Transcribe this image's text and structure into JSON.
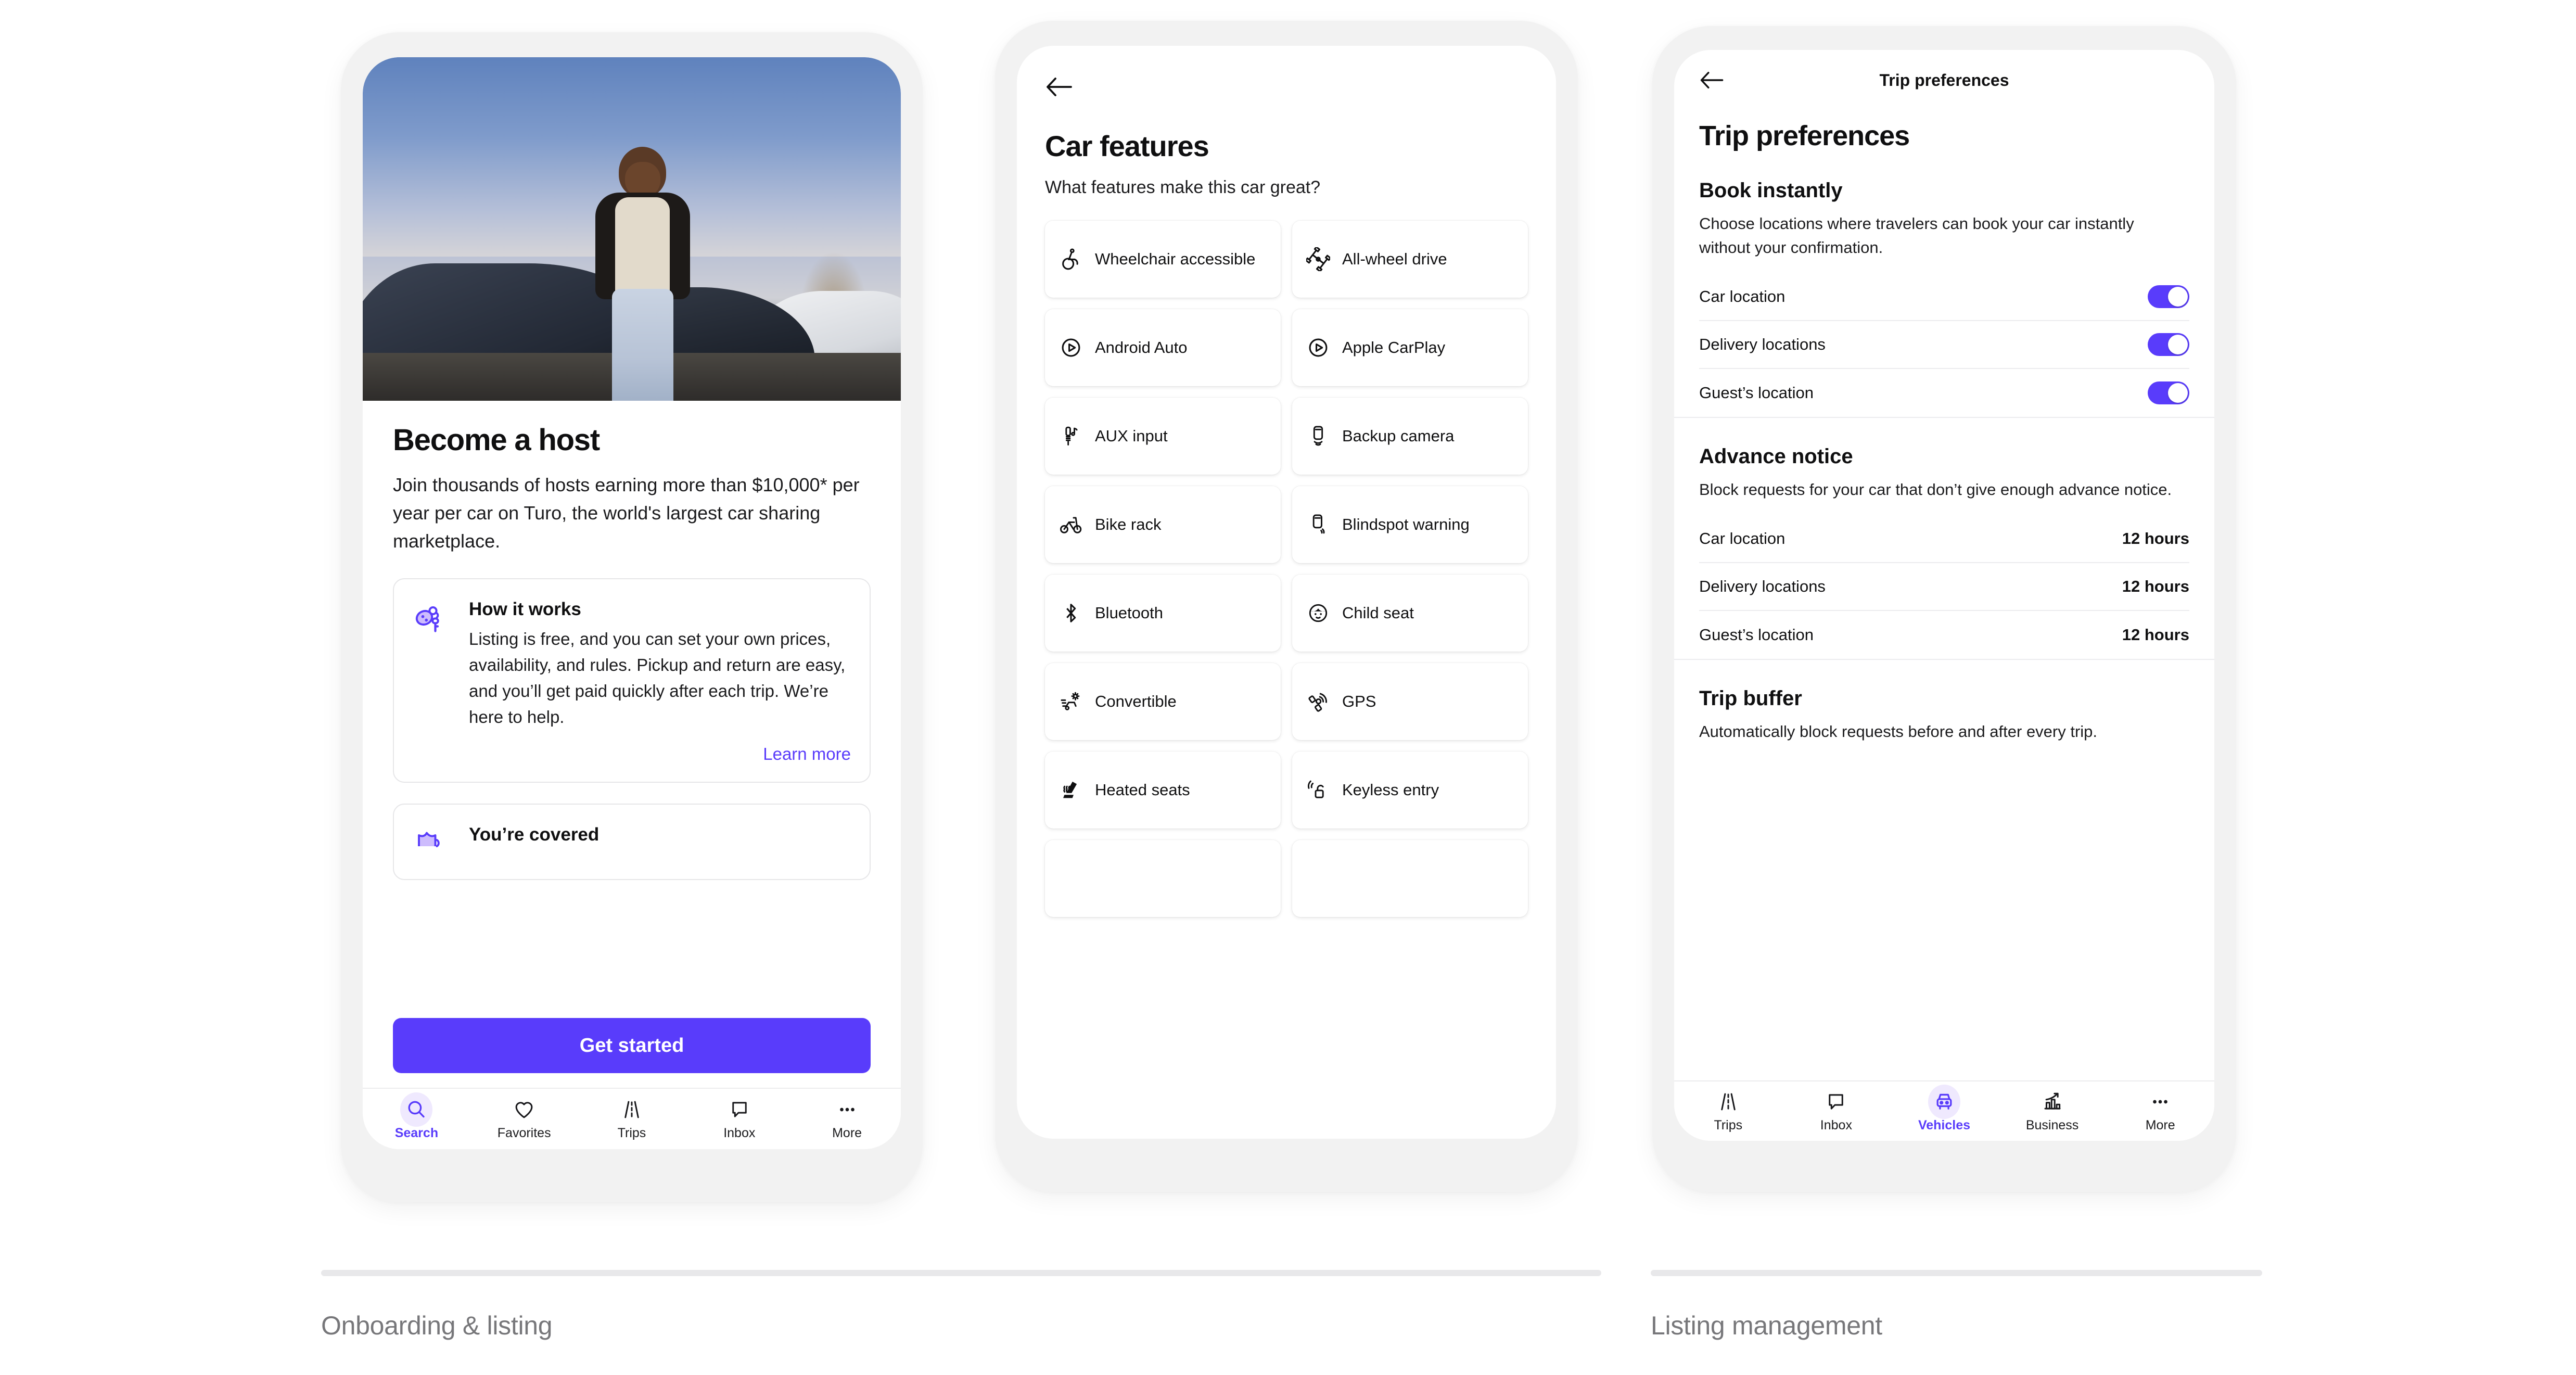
{
  "theme": {
    "accent": "#593CFB",
    "accent_soft": "#efe9fe",
    "text": "#0f0f10",
    "muted": "#77777a",
    "frame": "#f2f2f2"
  },
  "phone1": {
    "hero_alt": "host standing in front of parked sports cars",
    "title": "Become a host",
    "subtitle": "Join thousands of hosts earning more than $10,000* per year per car on Turo, the world's largest car sharing marketplace.",
    "cards": [
      {
        "icon": "car-keys-icon",
        "title": "How it works",
        "text": "Listing is free, and you can set your own prices, availability, and rules. Pickup and return are easy, and you’ll get paid quickly after each trip. We’re here to help.",
        "link": "Learn more"
      },
      {
        "icon": "shield-icon",
        "title": "You’re covered"
      }
    ],
    "cta": "Get started",
    "tabs": [
      {
        "label": "Search",
        "icon": "search-icon",
        "active": true
      },
      {
        "label": "Favorites",
        "icon": "heart-icon",
        "active": false
      },
      {
        "label": "Trips",
        "icon": "road-icon",
        "active": false
      },
      {
        "label": "Inbox",
        "icon": "message-icon",
        "active": false
      },
      {
        "label": "More",
        "icon": "ellipsis-icon",
        "active": false
      }
    ]
  },
  "phone2": {
    "back": "back-arrow-icon",
    "title": "Car features",
    "subtitle": "What features make this car great?",
    "features": [
      {
        "label": "Wheelchair accessible",
        "icon": "wheelchair-icon"
      },
      {
        "label": "All-wheel drive",
        "icon": "awd-icon"
      },
      {
        "label": "Android Auto",
        "icon": "play-circle-icon"
      },
      {
        "label": "Apple CarPlay",
        "icon": "play-circle-icon"
      },
      {
        "label": "AUX input",
        "icon": "aux-jack-icon"
      },
      {
        "label": "Backup camera",
        "icon": "backup-camera-icon"
      },
      {
        "label": "Bike rack",
        "icon": "bicycle-icon"
      },
      {
        "label": "Blindspot warning",
        "icon": "blindspot-icon"
      },
      {
        "label": "Bluetooth",
        "icon": "bluetooth-icon"
      },
      {
        "label": "Child seat",
        "icon": "child-face-icon"
      },
      {
        "label": "Convertible",
        "icon": "convertible-icon"
      },
      {
        "label": "GPS",
        "icon": "satellite-icon"
      },
      {
        "label": "Heated seats",
        "icon": "heated-seat-icon"
      },
      {
        "label": "Keyless entry",
        "icon": "keyless-lock-icon"
      },
      {
        "label": "",
        "icon": ""
      },
      {
        "label": "",
        "icon": ""
      }
    ]
  },
  "phone3": {
    "back": "back-arrow-icon",
    "header_title": "Trip preferences",
    "page_title": "Trip preferences",
    "sections": [
      {
        "heading": "Book instantly",
        "description": "Choose locations where travelers can book your car instantly without your confirmation.",
        "rows": [
          {
            "label": "Car location",
            "toggle": true
          },
          {
            "label": "Delivery locations",
            "toggle": true
          },
          {
            "label": "Guest’s location",
            "toggle": true
          }
        ]
      },
      {
        "heading": "Advance notice",
        "description": "Block requests for your car that don’t give enough advance notice.",
        "rows": [
          {
            "label": "Car location",
            "value": "12 hours"
          },
          {
            "label": "Delivery locations",
            "value": "12 hours"
          },
          {
            "label": "Guest’s location",
            "value": "12 hours"
          }
        ]
      },
      {
        "heading": "Trip buffer",
        "description": "Automatically block requests before and after every trip.",
        "rows": []
      }
    ],
    "tabs": [
      {
        "label": "Trips",
        "icon": "road-icon",
        "active": false
      },
      {
        "label": "Inbox",
        "icon": "message-icon",
        "active": false
      },
      {
        "label": "Vehicles",
        "icon": "car-icon",
        "active": true
      },
      {
        "label": "Business",
        "icon": "chart-up-icon",
        "active": false
      },
      {
        "label": "More",
        "icon": "ellipsis-icon",
        "active": false
      }
    ]
  },
  "captions": [
    {
      "label": "Onboarding & listing"
    },
    {
      "label": "Listing management"
    }
  ]
}
